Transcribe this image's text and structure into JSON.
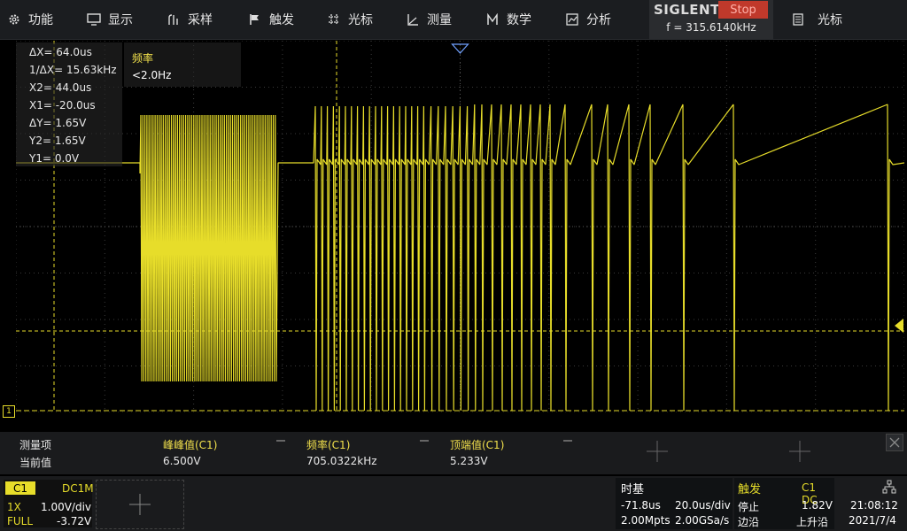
{
  "menu": {
    "items": [
      {
        "label": "功能",
        "icon": "gear-icon"
      },
      {
        "label": "显示",
        "icon": "monitor-icon"
      },
      {
        "label": "采样",
        "icon": "sample-icon"
      },
      {
        "label": "触发",
        "icon": "flag-icon"
      },
      {
        "label": "光标",
        "icon": "crosshair-icon"
      },
      {
        "label": "测量",
        "icon": "ruler-icon"
      },
      {
        "label": "数学",
        "icon": "math-icon"
      },
      {
        "label": "分析",
        "icon": "analysis-icon"
      }
    ],
    "right_item": {
      "label": "光标",
      "icon": "document-icon"
    }
  },
  "brand": {
    "name": "SIGLENT",
    "status": "Stop",
    "frequency": "f = 315.6140kHz"
  },
  "cursor_readout": {
    "dx": "ΔX= 64.0us",
    "inv_dx": "1/ΔX= 15.63kHz",
    "x2": "X2= 44.0us",
    "x1": "X1= -20.0us",
    "dy": "ΔY= 1.65V",
    "y2": "Y2= 1.65V",
    "y1": "Y1= 0.0V"
  },
  "freq_panel": {
    "title": "频率",
    "value": "<2.0Hz"
  },
  "channel_marker": "1",
  "measurements": {
    "row_labels": [
      "测量项",
      "当前值"
    ],
    "items": [
      {
        "name": "峰峰值(C1)",
        "value": "6.500V"
      },
      {
        "name": "频率(C1)",
        "value": "705.0322kHz"
      },
      {
        "name": "顶端值(C1)",
        "value": "5.233V"
      }
    ]
  },
  "channel": {
    "tag": "C1",
    "coupling": "DC1M",
    "probe": "1X",
    "scale": "1.00V/div",
    "bandwidth": "FULL",
    "offset": "-3.72V"
  },
  "timebase": {
    "title": "时基",
    "delay": "-71.8us",
    "scale": "20.0us/div",
    "memory": "2.00Mpts",
    "sample_rate": "2.00GSa/s"
  },
  "trigger": {
    "title": "触发",
    "source": "C1 DC",
    "state": "停止",
    "level": "1.82V",
    "mode_label": "边沿",
    "slope": "上升沿"
  },
  "clock": {
    "time": "21:08:12",
    "date": "2021/7/4"
  },
  "colors": {
    "trace": "#e7dd2a",
    "accent": "#f1e04c",
    "stop": "#c0392b"
  }
}
